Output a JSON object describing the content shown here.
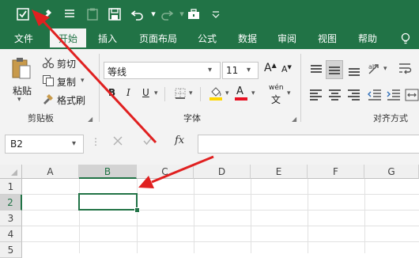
{
  "qat": {
    "icons": [
      "checkbox-icon",
      "format-painter-icon",
      "list-icon",
      "clipboard-icon",
      "save-icon",
      "undo-icon",
      "redo-icon",
      "toolbox-icon",
      "customize-icon"
    ]
  },
  "tabs": [
    {
      "label": "文件"
    },
    {
      "label": "开始",
      "active": true
    },
    {
      "label": "插入"
    },
    {
      "label": "页面布局"
    },
    {
      "label": "公式"
    },
    {
      "label": "数据"
    },
    {
      "label": "审阅"
    },
    {
      "label": "视图"
    },
    {
      "label": "帮助"
    }
  ],
  "ribbon": {
    "clipboard": {
      "paste": "粘贴",
      "paste_arrow": "▾",
      "cut": "剪切",
      "copy": "复制",
      "copy_arrow": "▾",
      "format_painter": "格式刷",
      "group_label": "剪贴板"
    },
    "font": {
      "font_name": "等线",
      "font_size": "11",
      "grow": "A",
      "shrink": "A",
      "bold": "B",
      "italic": "I",
      "underline": "U",
      "font_color": "A",
      "phonetic_top": "wén",
      "phonetic_bottom": "文",
      "group_label": "字体",
      "fill_color": "#ffd700",
      "font_color_value": "#e81123"
    },
    "alignment": {
      "group_label": "对齐方式"
    }
  },
  "formula_bar": {
    "name_box": "B2",
    "fx": "fx"
  },
  "grid": {
    "columns": [
      "A",
      "B",
      "C",
      "D",
      "E",
      "F",
      "G"
    ],
    "rows": [
      "1",
      "2",
      "3",
      "4",
      "5"
    ],
    "selected_cell": "B2"
  },
  "colors": {
    "accent": "#217346",
    "arrow": "#e02020"
  }
}
